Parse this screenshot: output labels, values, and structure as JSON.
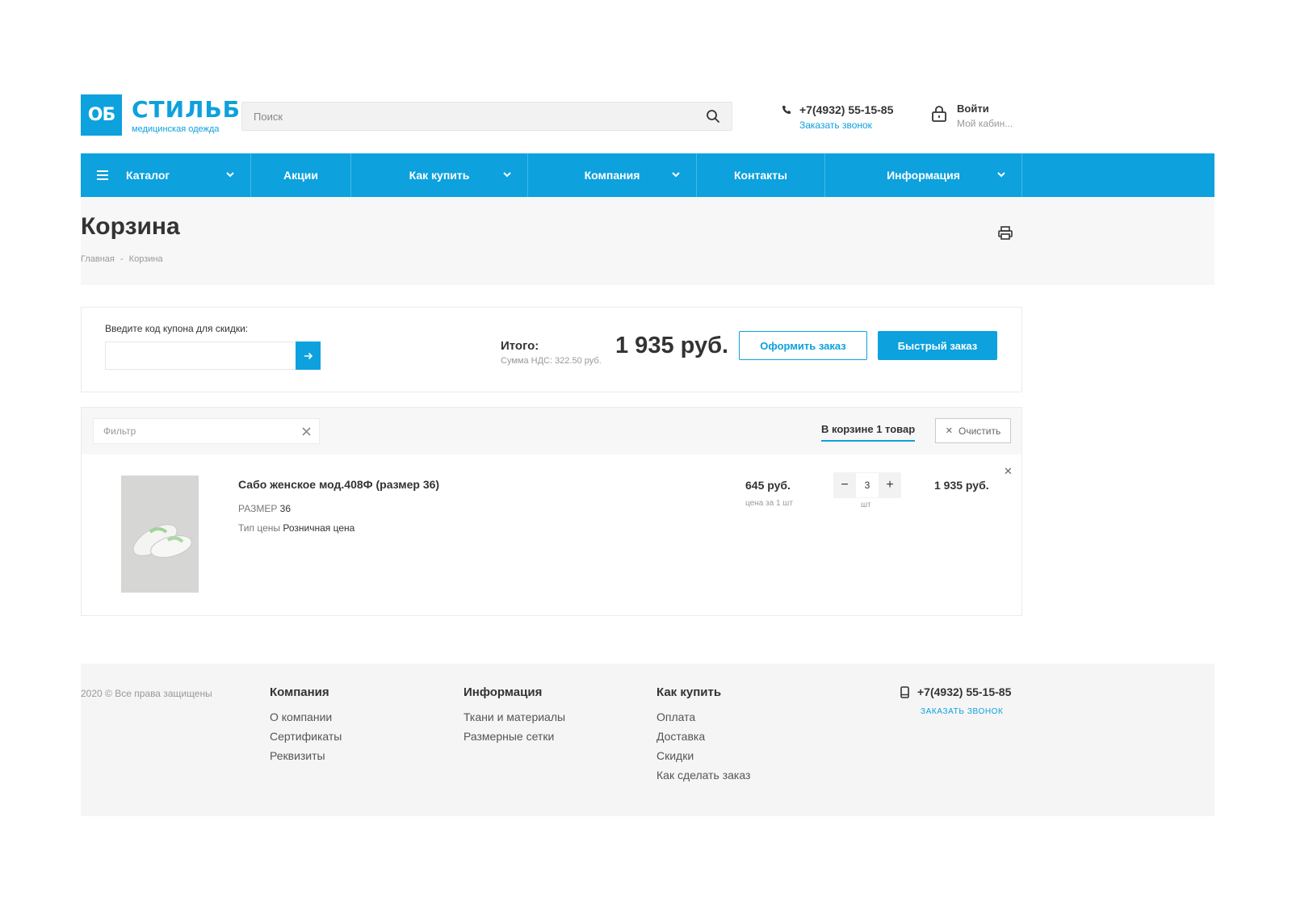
{
  "brand": {
    "logo_mark": "ОБ",
    "name": "СТИЛЬБ",
    "tagline": "медицинская одежда",
    "accent_color": "#0da1dd"
  },
  "search": {
    "placeholder": "Поиск",
    "value": ""
  },
  "header": {
    "phone": "+7(4932) 55-15-85",
    "callback": "Заказать звонок",
    "login_title": "Войти",
    "login_sub": "Мой кабин..."
  },
  "nav": {
    "items": [
      {
        "label": "Каталог",
        "dropdown": true
      },
      {
        "label": "Акции",
        "dropdown": false
      },
      {
        "label": "Как купить",
        "dropdown": true
      },
      {
        "label": "Компания",
        "dropdown": true
      },
      {
        "label": "Контакты",
        "dropdown": false
      },
      {
        "label": "Информация",
        "dropdown": true
      }
    ]
  },
  "page": {
    "title": "Корзина",
    "breadcrumb": [
      "Главная",
      "Корзина"
    ],
    "breadcrumb_sep": "-"
  },
  "summary": {
    "coupon_label": "Введите код купона для скидки:",
    "coupon_value": "",
    "total_label": "Итого:",
    "vat_text": "Сумма НДС: 322.50 руб.",
    "total_value": "1 935 руб.",
    "checkout_label": "Оформить заказ",
    "quick_order_label": "Быстрый заказ"
  },
  "cart": {
    "filter_placeholder": "Фильтр",
    "in_cart_label": "В корзине 1 товар",
    "clear_label": "Очистить",
    "items": [
      {
        "name": "Сабо женское мод.408Ф (размер 36)",
        "prop1_label": "РАЗМЕР",
        "prop1_value": "36",
        "prop2_label": "Тип цены",
        "prop2_value": "Розничная цена",
        "unit_price": "645 руб.",
        "unit_note": "цена за 1 шт",
        "quantity": "3",
        "qty_unit": "шт",
        "line_total": "1 935 руб."
      }
    ]
  },
  "footer": {
    "copyright": "2020 © Все права защищены",
    "columns": [
      {
        "title": "Компания",
        "links": [
          "О компании",
          "Сертификаты",
          "Реквизиты"
        ]
      },
      {
        "title": "Информация",
        "links": [
          "Ткани и материалы",
          "Размерные сетки"
        ]
      },
      {
        "title": "Как купить",
        "links": [
          "Оплата",
          "Доставка",
          "Скидки",
          "Как сделать заказ"
        ]
      }
    ],
    "phone": "+7(4932) 55-15-85",
    "callback": "заказать звонок"
  }
}
